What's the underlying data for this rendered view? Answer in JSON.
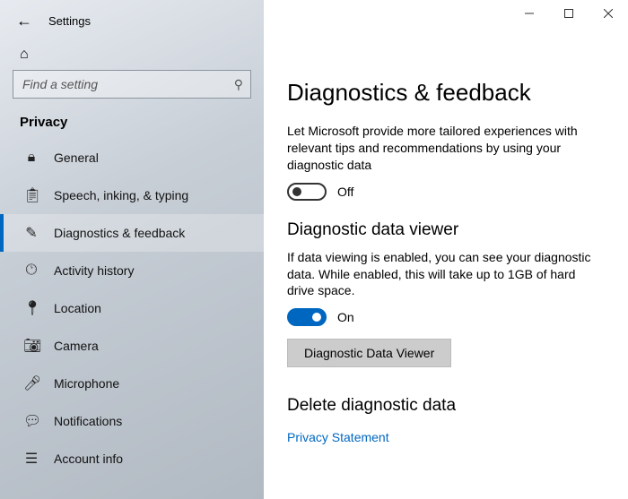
{
  "window": {
    "app_title": "Settings"
  },
  "search": {
    "placeholder": "Find a setting"
  },
  "category": "Privacy",
  "nav": [
    {
      "label": "General"
    },
    {
      "label": "Speech, inking, & typing"
    },
    {
      "label": "Diagnostics & feedback",
      "selected": true
    },
    {
      "label": "Activity history"
    },
    {
      "label": "Location"
    },
    {
      "label": "Camera"
    },
    {
      "label": "Microphone"
    },
    {
      "label": "Notifications"
    },
    {
      "label": "Account info"
    }
  ],
  "page": {
    "title": "Diagnostics & feedback",
    "tailored": {
      "desc": "Let Microsoft provide more tailored experiences with relevant tips and recommendations by using your diagnostic data",
      "state_label": "Off",
      "on": false
    },
    "viewer": {
      "heading": "Diagnostic data viewer",
      "desc": "If data viewing is enabled, you can see your diagnostic data. While enabled, this will take up to 1GB of hard drive space.",
      "state_label": "On",
      "on": true,
      "button": "Diagnostic Data Viewer"
    },
    "delete": {
      "heading": "Delete diagnostic data",
      "link": "Privacy Statement"
    }
  }
}
